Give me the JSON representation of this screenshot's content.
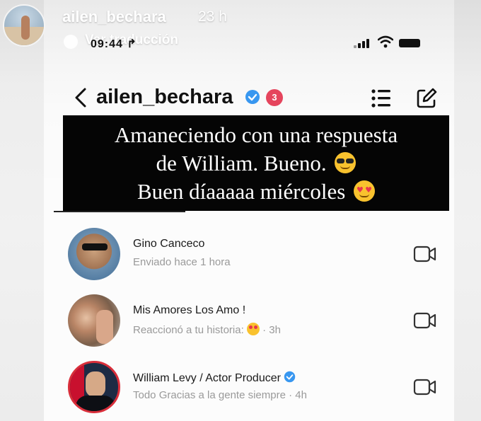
{
  "story": {
    "username": "ailen_bechara",
    "time_ago": "23 h",
    "translation_label": "Ver traducción"
  },
  "status_bar": {
    "time": "09:44 ↱"
  },
  "dm_header": {
    "title": "ailen_bechara",
    "badge_count": "3"
  },
  "caption": {
    "line1": "Amaneciendo con una respuesta",
    "line2": "de William. Bueno.",
    "line3": "Buen díaaaaa miércoles"
  },
  "chats": [
    {
      "name": "Gino Canceco",
      "status": "Enviado hace 1 hora"
    },
    {
      "name": "Mis Amores Los Amo !",
      "status": "Reaccionó a tu historia:",
      "status_suffix": " · 3h"
    },
    {
      "name": "William  Levy / Actor Producer",
      "status": "Todo Gracias a la gente siempre · 4h"
    }
  ],
  "colors": {
    "badge": "#e5455d",
    "verified": "#3897f0",
    "caption_bg": "#050505"
  },
  "icons": [
    "back-chevron",
    "verified-badge",
    "list",
    "edit",
    "video-camera",
    "heart-eyes-emoji",
    "sunglasses-emoji"
  ]
}
